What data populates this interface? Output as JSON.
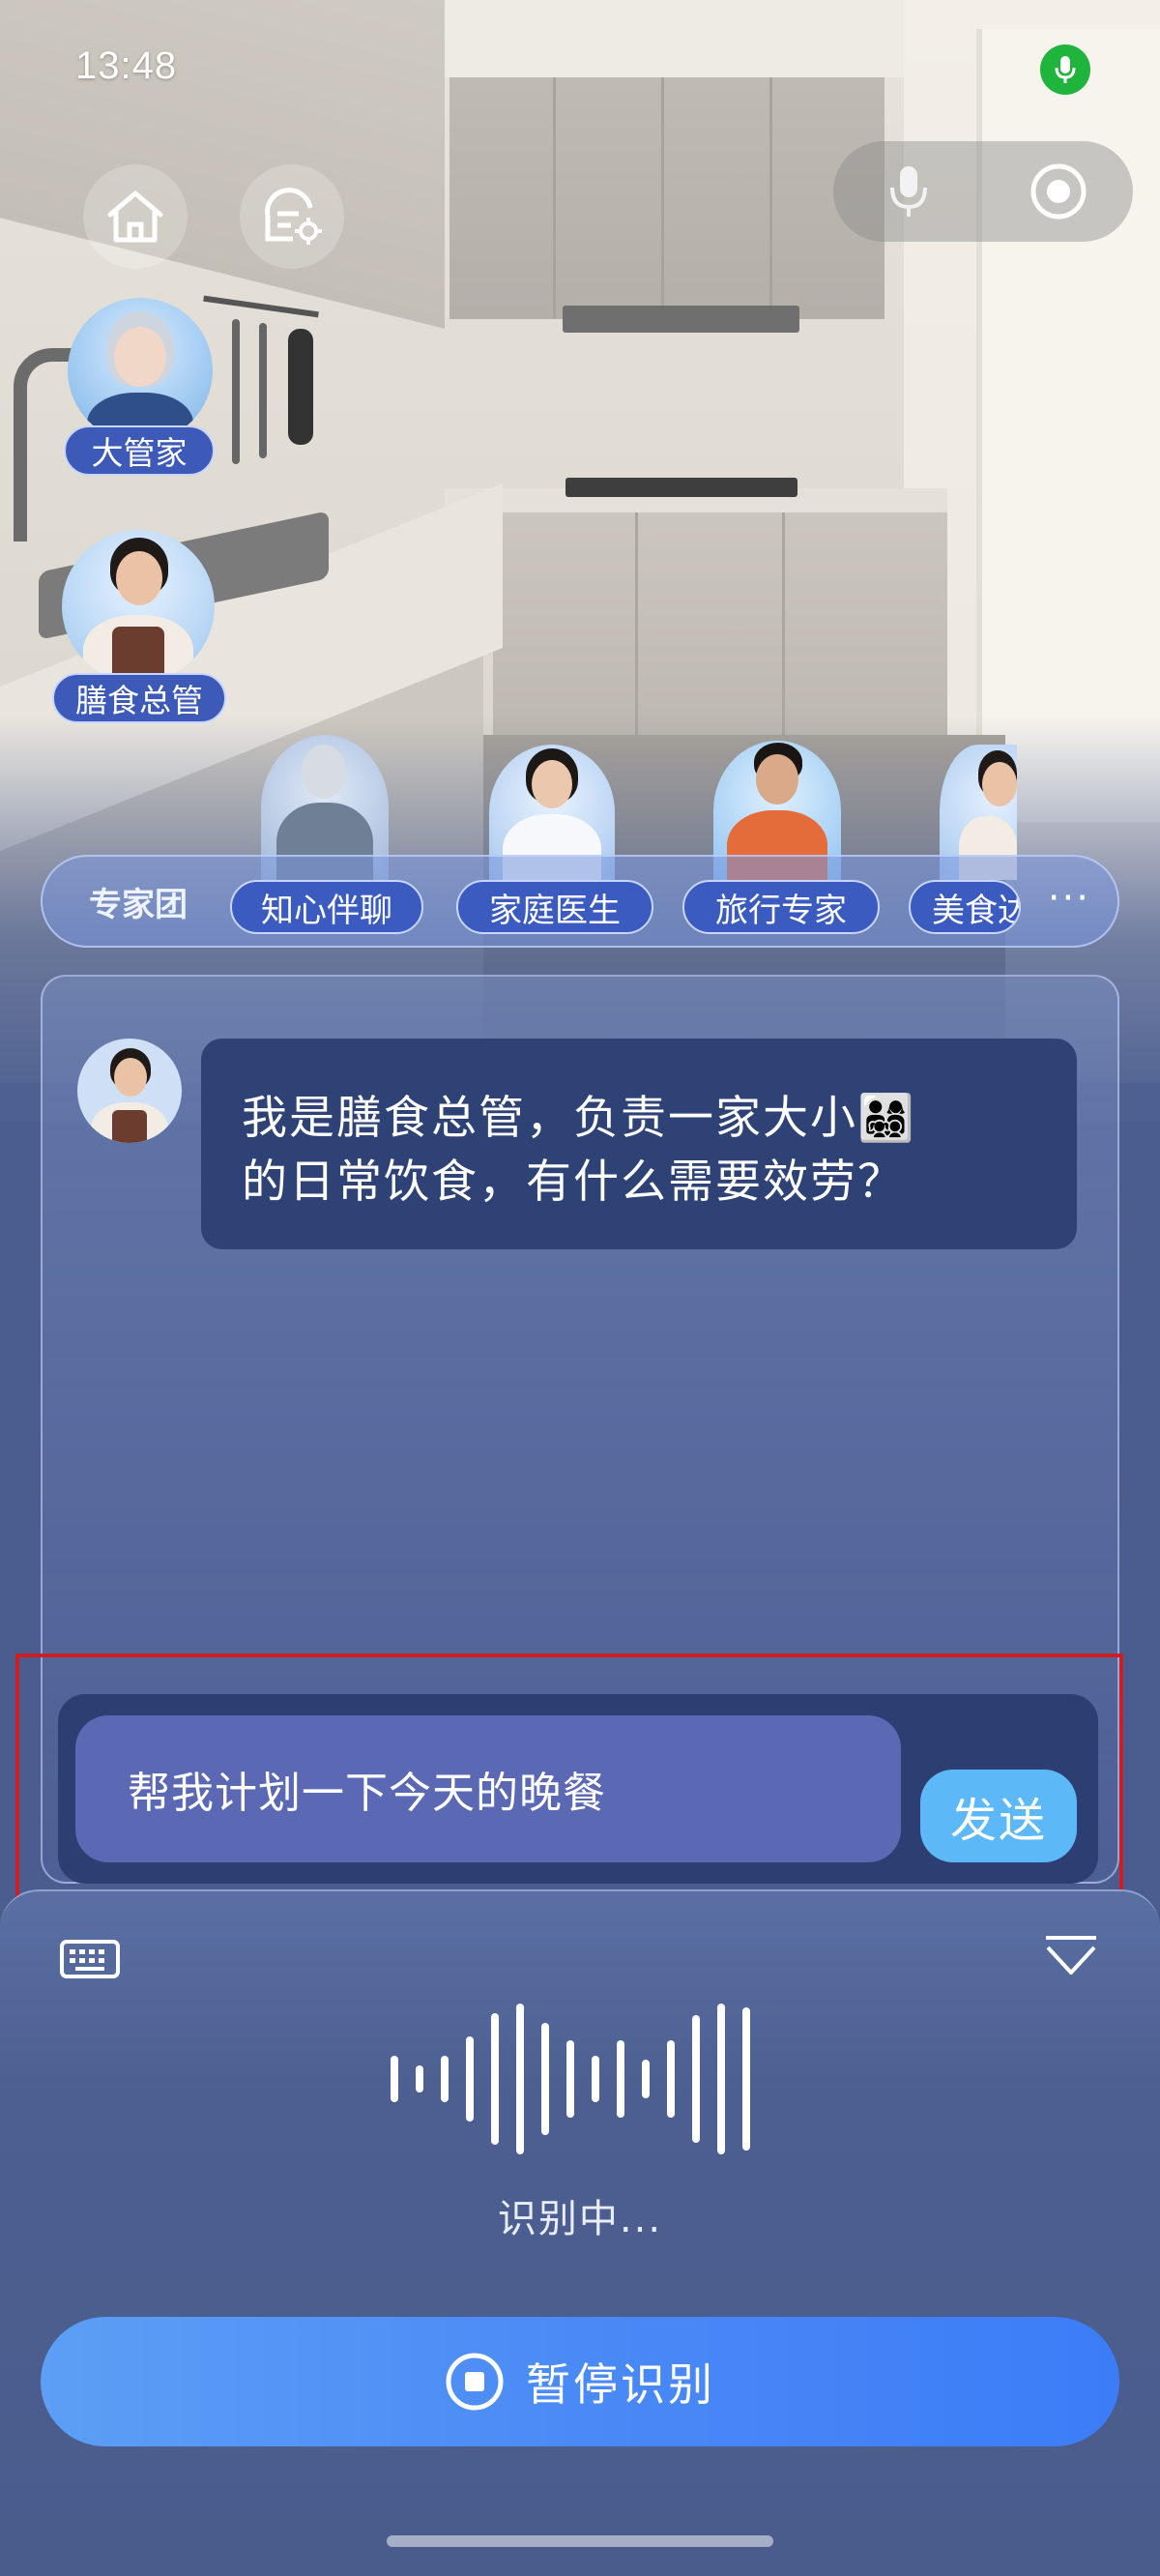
{
  "status_bar": {
    "time": "13:48"
  },
  "characters": {
    "butler": {
      "name": "大管家"
    },
    "chef": {
      "name": "膳食总管"
    }
  },
  "expert_team": {
    "title": "专家团",
    "experts": [
      {
        "name": "知心伴聊"
      },
      {
        "name": "家庭医生"
      },
      {
        "name": "旅行专家"
      },
      {
        "name": "美食达人"
      }
    ],
    "more": "···"
  },
  "chat": {
    "messages": [
      {
        "sender": "膳食总管",
        "line1": "我是膳食总管，负责一家大小👨‍👩‍👧‍👦",
        "line2": "的日常饮食，有什么需要效劳？"
      }
    ]
  },
  "input": {
    "value": "帮我计划一下今天的晚餐",
    "send_label": "发送"
  },
  "voice": {
    "status": "识别中...",
    "pause_label": "暂停识别"
  },
  "colors": {
    "accent_blue": "#4a8af6",
    "send_blue": "#5cb8f7",
    "mic_green": "#1fb53c",
    "highlight_red": "#cc1f24"
  }
}
